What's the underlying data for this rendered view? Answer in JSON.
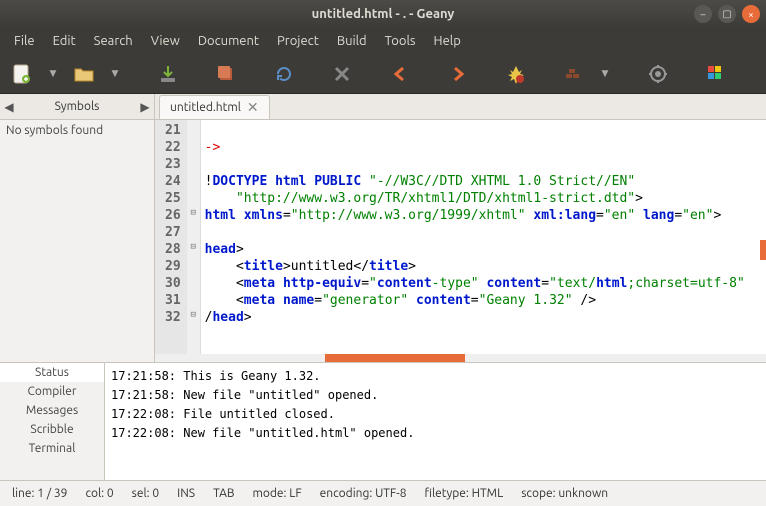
{
  "window": {
    "title": "untitled.html - . - Geany"
  },
  "menu": {
    "items": [
      "File",
      "Edit",
      "Search",
      "View",
      "Document",
      "Project",
      "Build",
      "Tools",
      "Help"
    ]
  },
  "sidebar": {
    "tab": "Symbols",
    "body": "No symbols found"
  },
  "editorTab": {
    "label": "untitled.html"
  },
  "code": {
    "startLine": 21,
    "lines": [
      "",
      "->",
      "",
      "!DOCTYPE html PUBLIC \"-//W3C//DTD XHTML 1.0 Strict//EN\"",
      "    \"http://www.w3.org/TR/xhtml1/DTD/xhtml1-strict.dtd\">",
      "html xmlns=\"http://www.w3.org/1999/xhtml\" xml:lang=\"en\" lang=\"en\">",
      "",
      "head>",
      "    <title>untitled</title>",
      "    <meta http-equiv=\"content-type\" content=\"text/html;charset=utf-8\"",
      "    <meta name=\"generator\" content=\"Geany 1.32\" />",
      "/head>"
    ]
  },
  "messages": {
    "tabs": [
      "Status",
      "Compiler",
      "Messages",
      "Scribble",
      "Terminal"
    ],
    "lines": [
      "17:21:58: This is Geany 1.32.",
      "17:21:58: New file \"untitled\" opened.",
      "17:22:08: File untitled closed.",
      "17:22:08: New file \"untitled.html\" opened."
    ]
  },
  "status": {
    "pos": "line: 1 / 39",
    "col": "col: 0",
    "sel": "sel: 0",
    "ins": "INS",
    "tab": "TAB",
    "mode": "mode: LF",
    "encoding": "encoding: UTF-8",
    "filetype": "filetype: HTML",
    "scope": "scope: unknown"
  }
}
